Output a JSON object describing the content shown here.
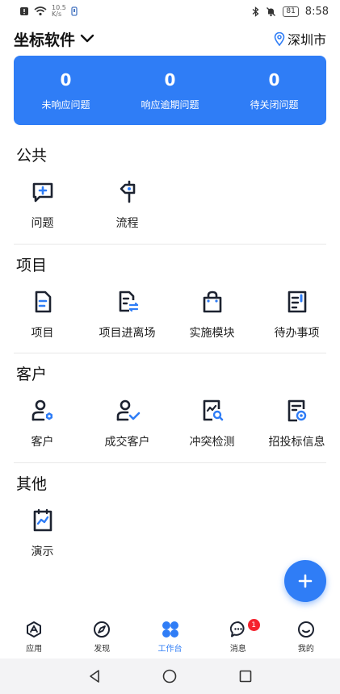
{
  "status": {
    "netspeed_value": "10.5",
    "netspeed_unit": "K/s",
    "battery": "81",
    "time": "8:58"
  },
  "header": {
    "company": "坐标软件",
    "location": "深圳市"
  },
  "stats": [
    {
      "value": "0",
      "label": "未响应问题"
    },
    {
      "value": "0",
      "label": "响应逾期问题"
    },
    {
      "value": "0",
      "label": "待关闭问题"
    }
  ],
  "sections": {
    "public": {
      "title": "公共",
      "items": [
        {
          "label": "问题"
        },
        {
          "label": "流程"
        }
      ]
    },
    "project": {
      "title": "项目",
      "items": [
        {
          "label": "项目"
        },
        {
          "label": "项目进离场"
        },
        {
          "label": "实施模块"
        },
        {
          "label": "待办事项"
        }
      ]
    },
    "customer": {
      "title": "客户",
      "items": [
        {
          "label": "客户"
        },
        {
          "label": "成交客户"
        },
        {
          "label": "冲突检测"
        },
        {
          "label": "招投标信息"
        }
      ]
    },
    "other": {
      "title": "其他",
      "items": [
        {
          "label": "演示"
        }
      ]
    }
  },
  "tabs": [
    {
      "label": "应用",
      "icon": "app-icon"
    },
    {
      "label": "发现",
      "icon": "compass-icon"
    },
    {
      "label": "工作台",
      "icon": "workbench-icon",
      "active": true
    },
    {
      "label": "消息",
      "icon": "message-icon",
      "badge": "1"
    },
    {
      "label": "我的",
      "icon": "profile-icon"
    }
  ],
  "colors": {
    "accent": "#2f7df6",
    "icon_dark": "#1c2230",
    "badge": "#f5222d"
  }
}
